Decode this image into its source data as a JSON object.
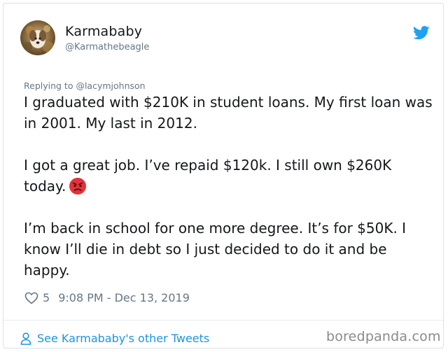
{
  "author": {
    "display_name": "Karmababy",
    "handle": "@Karmathebeagle"
  },
  "reply": {
    "text": "Replying to @lacymjohnson"
  },
  "tweet": {
    "paragraph1": "I graduated with $210K in student loans. My first loan was in 2001. My last in 2012.",
    "paragraph2": "I got a great job. I’ve repaid $120k. I still own $260K today.",
    "paragraph3": "I’m back in school for one more degree. It’s for $50K. I know I’ll die in debt so I just decided to do it and be happy."
  },
  "meta": {
    "likes": "5",
    "timestamp": "9:08 PM - Dec 13, 2019"
  },
  "footer": {
    "link_text": "See Karmababy's other Tweets",
    "watermark": "boredpanda.com"
  },
  "icons": {
    "twitter": "twitter-bird-icon",
    "heart": "heart-outline-icon",
    "person": "person-icon",
    "emoji": "angry-face-emoji"
  },
  "colors": {
    "link_blue": "#1b95e0",
    "twitter_blue": "#1da1f2",
    "secondary_text": "#657786",
    "emoji_red": "#e0333a"
  }
}
